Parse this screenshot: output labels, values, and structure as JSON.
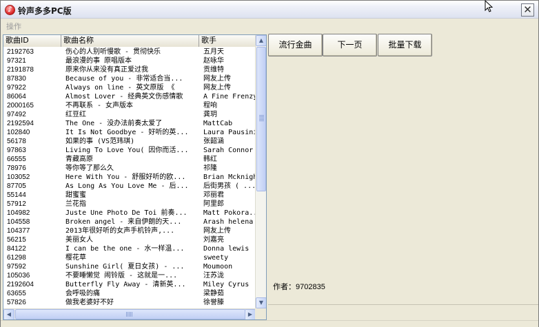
{
  "window": {
    "title": "铃声多多PC版",
    "close_glyph": "✕"
  },
  "menu": {
    "operate": "操作"
  },
  "table": {
    "columns": [
      "歌曲ID",
      "歌曲名称",
      "歌手"
    ],
    "rows": [
      [
        "2192763",
        "伤心的人别听慢歌 - 贯彻快乐",
        "五月天"
      ],
      [
        "97321",
        "最浪漫的事 原唱版本",
        "赵咏华"
      ],
      [
        "2191878",
        "原来你从来没有真正爱过我",
        "贡维特"
      ],
      [
        "87830",
        "Because of you - 非常适合当...",
        "网友上传"
      ],
      [
        "97922",
        "Always on line - 英文原版 《",
        "网友上传"
      ],
      [
        "86064",
        "Almost Lover - 经典英文伤感情歌",
        "A Fine Frenzy"
      ],
      [
        "2000165",
        "不再联系 - 女声版本",
        "程响"
      ],
      [
        "97492",
        "红豆红",
        "龚玥"
      ],
      [
        "2192594",
        "The One - 没办法前奏太爱了",
        "MattCab"
      ],
      [
        "102840",
        "It Is Not Goodbye - 好听的英...",
        "Laura Pausini"
      ],
      [
        "56178",
        "如果的事 (VS范玮琪)",
        "张韶涵"
      ],
      [
        "97863",
        "Living To Love You( 因你而活...",
        "Sarah Connor"
      ],
      [
        "66555",
        "青藏高原",
        "韩红"
      ],
      [
        "78976",
        "等你等了那么久",
        "祁隆"
      ],
      [
        "103052",
        "Here With You - 舒服好听的欧...",
        "Brian Mcknight"
      ],
      [
        "87705",
        "As Long As You Love Me - 后...",
        "后街男孩 ( ..."
      ],
      [
        "55144",
        "甜蜜蜜",
        "邓丽君"
      ],
      [
        "57912",
        "兰花指",
        "阿里郎"
      ],
      [
        "104982",
        "Juste Une Photo De Toi 前奏...",
        "Matt Pokora..."
      ],
      [
        "104558",
        "Broken angel - 来自伊朗的天...",
        "Arash helena"
      ],
      [
        "104377",
        "2013年很好听的女声手机铃声,...",
        "网友上传"
      ],
      [
        "56215",
        "美丽女人",
        "刘嘉亮"
      ],
      [
        "84122",
        "I can be the one - 水一样温...",
        "Donna lewis"
      ],
      [
        "61298",
        "樱花草",
        "sweety"
      ],
      [
        "97592",
        "Sunshine Girl( 夏日女孩) - ...",
        "Moumoon"
      ],
      [
        "105036",
        "不要睡懒觉 闹铃版 - 这就是一...",
        "汪苏泷"
      ],
      [
        "2192604",
        "Butterfly Fly Away - 清新英...",
        "Miley Cyrus"
      ],
      [
        "63655",
        "会呼吸的痛",
        "梁静茹"
      ],
      [
        "57826",
        "做我老婆好不好",
        "徐誉滕"
      ]
    ]
  },
  "buttons": {
    "popular": "流行金曲",
    "next_page": "下一页",
    "batch_download": "批量下载"
  },
  "author": "作者：9702835",
  "scroll": {
    "up_glyph": "▲",
    "down_glyph": "▼",
    "left_glyph": "◀",
    "right_glyph": "▶"
  }
}
